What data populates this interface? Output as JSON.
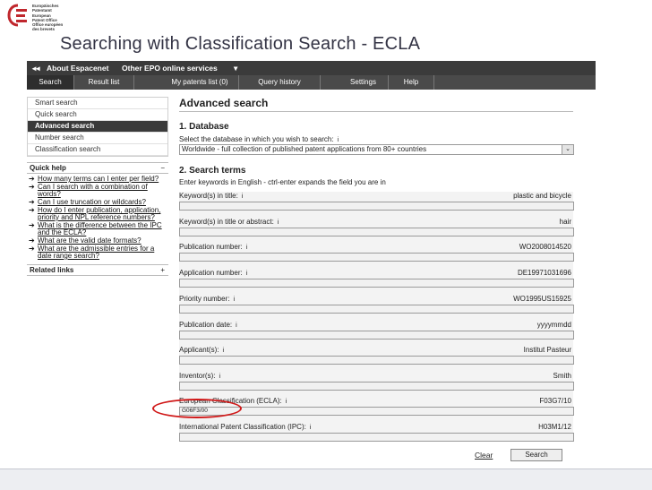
{
  "logo": {
    "lines": [
      "Europäisches",
      "Patentamt",
      "European",
      "Patent Office",
      "Office européen",
      "des brevets"
    ]
  },
  "slide_title": "Searching with Classification Search - ECLA",
  "topbar": {
    "back_icon": "double-left-arrow-icon",
    "about": "About Espacenet",
    "other": "Other EPO online services",
    "dropdown_icon": "down-triangle-icon"
  },
  "tabs": [
    {
      "label": "Search",
      "active": true
    },
    {
      "label": "Result list"
    },
    {
      "label": "My patents list (0)"
    },
    {
      "label": "Query history"
    },
    {
      "label": "Settings"
    },
    {
      "label": "Help"
    }
  ],
  "sidebar": {
    "nav": [
      "Smart search",
      "Quick search",
      "Advanced search",
      "Number search",
      "Classification search"
    ],
    "quick_help_title": "Quick help",
    "quick_help_toggle": "−",
    "quick_help_items": [
      "How many terms can I enter per field?",
      "Can I search with a combination of words?",
      "Can I use truncation or wildcards?",
      "How do I enter publication, application, priority and NPL reference numbers?",
      "What is the difference between the IPC and the ECLA?",
      "What are the valid date formats?",
      "What are the admissible entries for a date range search?"
    ],
    "related_links": "Related links",
    "related_toggle": "+"
  },
  "main": {
    "title": "Advanced search",
    "database_title": "1. Database",
    "database_hint": "Select the database in which you wish to search:",
    "info_glyph": "i",
    "database_value": "Worldwide - full collection of published patent applications from 80+ countries",
    "terms_title": "2. Search terms",
    "terms_hint": "Enter keywords in English - ctrl-enter expands the field you are in",
    "fields": [
      {
        "label": "Keyword(s) in title:",
        "example": "plastic and bicycle",
        "value": ""
      },
      {
        "label": "Keyword(s) in title or abstract:",
        "example": "hair",
        "value": ""
      },
      {
        "label": "Publication number:",
        "example": "WO2008014520",
        "value": ""
      },
      {
        "label": "Application number:",
        "example": "DE19971031696",
        "value": ""
      },
      {
        "label": "Priority number:",
        "example": "WO1995US15925",
        "value": ""
      },
      {
        "label": "Publication date:",
        "example": "yyyymmdd",
        "value": ""
      },
      {
        "label": "Applicant(s):",
        "example": "Institut Pasteur",
        "value": ""
      },
      {
        "label": "Inventor(s):",
        "example": "Smith",
        "value": ""
      },
      {
        "label": "European Classification (ECLA):",
        "example": "F03G7/10",
        "value": "G06F3/00"
      },
      {
        "label": "International Patent Classification (IPC):",
        "example": "H03M1/12",
        "value": ""
      }
    ],
    "clear_label": "Clear",
    "search_label": "Search"
  },
  "colors": {
    "highlight_oval": "#d01818",
    "topbar": "#3b3b3b",
    "active_nav": "#3a3a3a"
  }
}
